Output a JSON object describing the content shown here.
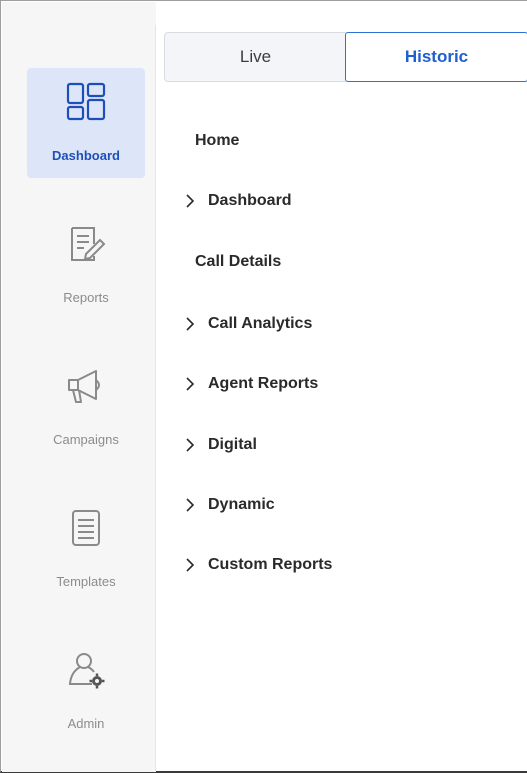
{
  "sidebar": {
    "items": [
      {
        "label": "Dashboard",
        "icon": "dashboard-grid-icon",
        "active": true
      },
      {
        "label": "Reports",
        "icon": "report-edit-icon",
        "active": false
      },
      {
        "label": "Campaigns",
        "icon": "megaphone-icon",
        "active": false
      },
      {
        "label": "Templates",
        "icon": "document-lines-icon",
        "active": false
      },
      {
        "label": "Admin",
        "icon": "user-gear-icon",
        "active": false
      }
    ]
  },
  "tabs": {
    "live": "Live",
    "historic": "Historic",
    "selected": "Historic"
  },
  "menu": {
    "items": [
      {
        "label": "Home",
        "expandable": false
      },
      {
        "label": "Dashboard",
        "expandable": true
      },
      {
        "label": "Call Details",
        "expandable": false
      },
      {
        "label": "Call Analytics",
        "expandable": true
      },
      {
        "label": "Agent Reports",
        "expandable": true
      },
      {
        "label": "Digital",
        "expandable": true
      },
      {
        "label": "Dynamic",
        "expandable": true
      },
      {
        "label": "Custom Reports",
        "expandable": true
      }
    ]
  },
  "colors": {
    "accent": "#2f6fd8",
    "active_nav_bg": "#dde6f8",
    "sidebar_bg": "#f6f6f6"
  }
}
